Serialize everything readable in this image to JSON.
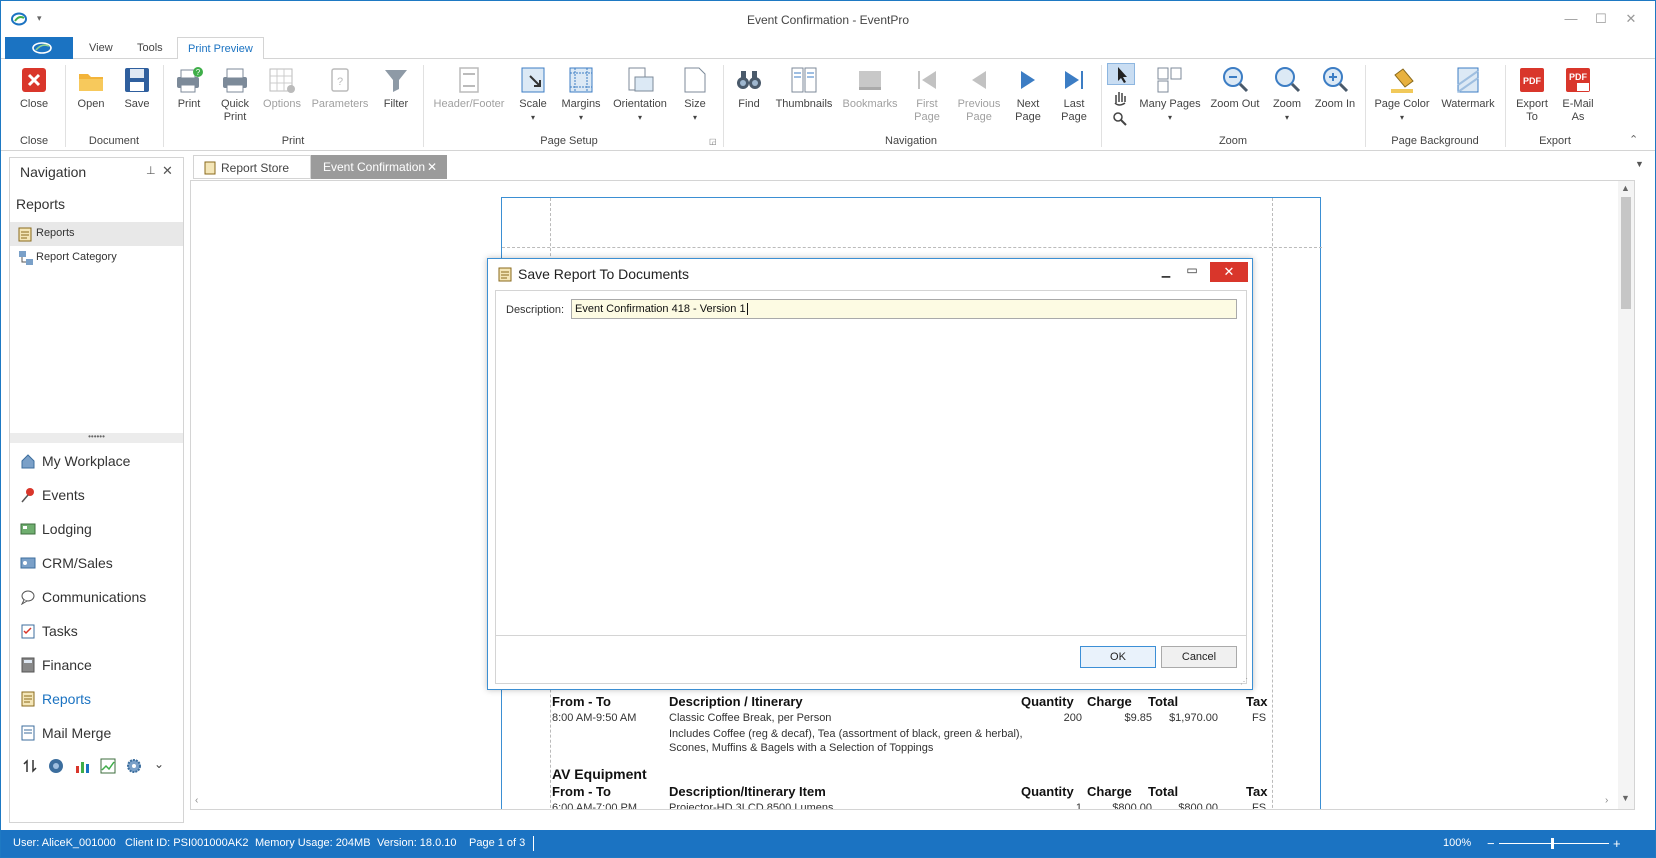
{
  "window": {
    "title": "Event Confirmation - EventPro"
  },
  "ribbon_tabs": [
    "View",
    "Tools",
    "Print Preview"
  ],
  "ribbon": {
    "close": {
      "label": "Close",
      "group": "Close"
    },
    "document": {
      "open": "Open",
      "save": "Save",
      "group": "Document"
    },
    "print": {
      "print": "Print",
      "quick_print": "Quick Print",
      "options": "Options",
      "parameters": "Parameters",
      "filter": "Filter",
      "group": "Print"
    },
    "page_setup": {
      "header_footer": "Header/Footer",
      "scale": "Scale",
      "margins": "Margins",
      "orientation": "Orientation",
      "size": "Size",
      "group": "Page Setup"
    },
    "navigation": {
      "find": "Find",
      "thumbnails": "Thumbnails",
      "bookmarks": "Bookmarks",
      "first_page": "First Page",
      "previous_page": "Previous Page",
      "next_page": "Next Page",
      "last_page": "Last Page",
      "group": "Navigation"
    },
    "zoom": {
      "many_pages": "Many Pages",
      "zoom_out": "Zoom Out",
      "zoom": "Zoom",
      "zoom_in": "Zoom In",
      "group": "Zoom"
    },
    "page_background": {
      "page_color": "Page Color",
      "watermark": "Watermark",
      "group": "Page Background"
    },
    "export": {
      "export_to": "Export To",
      "email_as": "E-Mail As",
      "group": "Export"
    }
  },
  "nav_pane": {
    "title": "Navigation",
    "section": "Reports",
    "items": [
      "Reports",
      "Report Category"
    ],
    "modules": [
      "My Workplace",
      "Events",
      "Lodging",
      "CRM/Sales",
      "Communications",
      "Tasks",
      "Finance",
      "Reports",
      "Mail Merge"
    ]
  },
  "doc_tabs": [
    "Report Store",
    "Event Confirmation"
  ],
  "report": {
    "section1": {
      "headers": [
        "From - To",
        "Description / Itinerary",
        "Quantity",
        "Charge",
        "Total",
        "Tax"
      ],
      "row": {
        "time": "8:00 AM-9:50 AM",
        "desc": "Classic Coffee Break, per Person",
        "qty": "200",
        "charge": "$9.85",
        "total": "$1,970.00",
        "tax": "FS"
      },
      "note1": "Includes Coffee (reg & decaf), Tea (assortment of black, green & herbal),",
      "note2": "Scones, Muffins & Bagels with a Selection of Toppings"
    },
    "section2": {
      "title": "AV Equipment",
      "headers": [
        "From - To",
        "Description/Itinerary Item",
        "Quantity",
        "Charge",
        "Total",
        "Tax"
      ],
      "row": {
        "time": "6:00 AM-7:00 PM",
        "desc": "Projector-HD 3LCD 8500 Lumens",
        "qty": "1",
        "charge": "$800.00",
        "total": "$800.00",
        "tax": "FS"
      }
    }
  },
  "dialog": {
    "title": "Save Report To Documents",
    "description_label": "Description:",
    "description_value": "Event Confirmation 418 - Version 1",
    "ok": "OK",
    "cancel": "Cancel"
  },
  "status": {
    "user": "User: AliceK_001000",
    "client": "Client ID: PSI001000AK2",
    "memory": "Memory Usage: 204MB",
    "version": "Version: 18.0.10",
    "page": "Page 1 of 3",
    "zoom": "100%"
  }
}
